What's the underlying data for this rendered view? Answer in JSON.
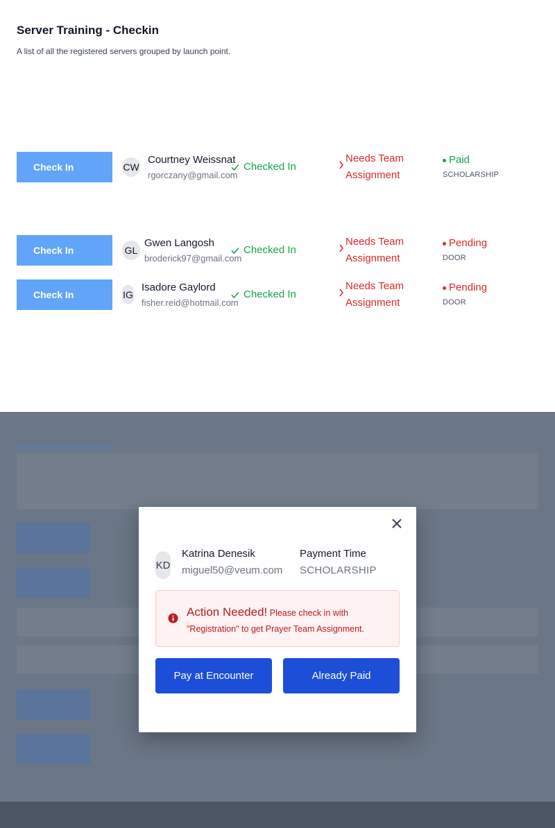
{
  "header": {
    "title": "Server Training - Checkin",
    "subtitle": "A list of all the registered servers grouped by launch point."
  },
  "rows": [
    {
      "action": "Check In",
      "initials": "CW",
      "name": "Courtney Weissnat",
      "email": "rgorczany@gmail.com",
      "status": "Checked In",
      "prayer": [
        "Needs Team",
        "Assignment"
      ],
      "payment": "Paid",
      "payment_type": "SCHOLARSHIP"
    },
    {
      "action": "Check In",
      "initials": "GL",
      "name": "Gwen Langosh",
      "email": "broderick97@gmail.com",
      "status": "Checked In",
      "prayer": [
        "Needs Team",
        "Assignment"
      ],
      "payment": "Pending",
      "payment_type": "DOOR"
    },
    {
      "action": "Check In",
      "initials": "IG",
      "name": "Isadore Gaylord",
      "email": "fisher.reid@hotmail.com",
      "status": "Checked In",
      "prayer": [
        "Needs Team",
        "Assignment"
      ],
      "payment": "Pending",
      "payment_type": "DOOR"
    }
  ],
  "modal": {
    "initials": "KD",
    "name": "Katrina Denesik",
    "email": "miguel50@veum.com",
    "payment_label": "Payment Time",
    "payment_value": "SCHOLARSHIP",
    "alert_title": "Action Needed!",
    "alert_message": "Please check in with \"Registration\" to get Prayer Team Assignment.",
    "pay_button": "Pay at Encounter",
    "paid_button": "Already Paid"
  },
  "colors": {
    "primary": "#1d4ed8",
    "check_in_button": "#60a5fa",
    "success": "#16a34a",
    "danger": "#dc2626"
  },
  "icons": [
    "check-icon",
    "chevron-right-icon",
    "close-icon",
    "info-circle-icon"
  ]
}
